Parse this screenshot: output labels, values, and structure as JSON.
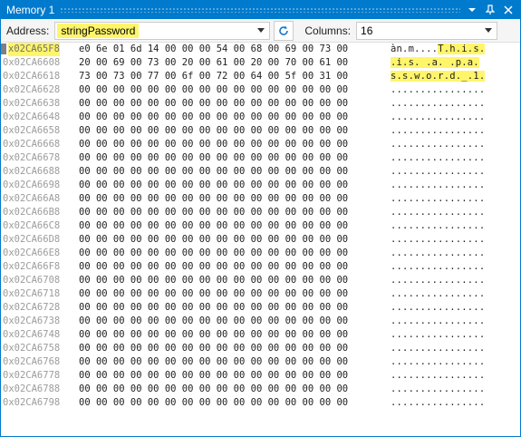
{
  "window": {
    "title": "Memory 1",
    "title_icons": [
      "dropdown-icon",
      "pin-icon",
      "close-icon"
    ],
    "accent": "#007acc"
  },
  "toolbar": {
    "address_label": "Address:",
    "address_value": "stringPassword",
    "columns_label": "Columns:",
    "columns_value": "16",
    "highlight_color": "#fff56b"
  },
  "rows": [
    {
      "addr": "x02CA65F8",
      "hex": "e0 6e 01 6d 14 00 00 00 54 00 68 00 69 00 73 00",
      "ascii_pre": "àn.m....",
      "ascii_hl": "T.h.i.s."
    },
    {
      "addr": "0x02CA6608",
      "hex": "20 00 69 00 73 00 20 00 61 00 20 00 70 00 61 00",
      "ascii_pre": "",
      "ascii_hl": ".i.s. .a. .p.a."
    },
    {
      "addr": "0x02CA6618",
      "hex": "73 00 73 00 77 00 6f 00 72 00 64 00 5f 00 31 00",
      "ascii_pre": "",
      "ascii_hl": "s.s.w.o.r.d._.1."
    },
    {
      "addr": "0x02CA6628",
      "hex": "00 00 00 00 00 00 00 00 00 00 00 00 00 00 00 00",
      "ascii_pre": "................",
      "ascii_hl": ""
    },
    {
      "addr": "0x02CA6638",
      "hex": "00 00 00 00 00 00 00 00 00 00 00 00 00 00 00 00",
      "ascii_pre": "................",
      "ascii_hl": ""
    },
    {
      "addr": "0x02CA6648",
      "hex": "00 00 00 00 00 00 00 00 00 00 00 00 00 00 00 00",
      "ascii_pre": "................",
      "ascii_hl": ""
    },
    {
      "addr": "0x02CA6658",
      "hex": "00 00 00 00 00 00 00 00 00 00 00 00 00 00 00 00",
      "ascii_pre": "................",
      "ascii_hl": ""
    },
    {
      "addr": "0x02CA6668",
      "hex": "00 00 00 00 00 00 00 00 00 00 00 00 00 00 00 00",
      "ascii_pre": "................",
      "ascii_hl": ""
    },
    {
      "addr": "0x02CA6678",
      "hex": "00 00 00 00 00 00 00 00 00 00 00 00 00 00 00 00",
      "ascii_pre": "................",
      "ascii_hl": ""
    },
    {
      "addr": "0x02CA6688",
      "hex": "00 00 00 00 00 00 00 00 00 00 00 00 00 00 00 00",
      "ascii_pre": "................",
      "ascii_hl": ""
    },
    {
      "addr": "0x02CA6698",
      "hex": "00 00 00 00 00 00 00 00 00 00 00 00 00 00 00 00",
      "ascii_pre": "................",
      "ascii_hl": ""
    },
    {
      "addr": "0x02CA66A8",
      "hex": "00 00 00 00 00 00 00 00 00 00 00 00 00 00 00 00",
      "ascii_pre": "................",
      "ascii_hl": ""
    },
    {
      "addr": "0x02CA66B8",
      "hex": "00 00 00 00 00 00 00 00 00 00 00 00 00 00 00 00",
      "ascii_pre": "................",
      "ascii_hl": ""
    },
    {
      "addr": "0x02CA66C8",
      "hex": "00 00 00 00 00 00 00 00 00 00 00 00 00 00 00 00",
      "ascii_pre": "................",
      "ascii_hl": ""
    },
    {
      "addr": "0x02CA66D8",
      "hex": "00 00 00 00 00 00 00 00 00 00 00 00 00 00 00 00",
      "ascii_pre": "................",
      "ascii_hl": ""
    },
    {
      "addr": "0x02CA66E8",
      "hex": "00 00 00 00 00 00 00 00 00 00 00 00 00 00 00 00",
      "ascii_pre": "................",
      "ascii_hl": ""
    },
    {
      "addr": "0x02CA66F8",
      "hex": "00 00 00 00 00 00 00 00 00 00 00 00 00 00 00 00",
      "ascii_pre": "................",
      "ascii_hl": ""
    },
    {
      "addr": "0x02CA6708",
      "hex": "00 00 00 00 00 00 00 00 00 00 00 00 00 00 00 00",
      "ascii_pre": "................",
      "ascii_hl": ""
    },
    {
      "addr": "0x02CA6718",
      "hex": "00 00 00 00 00 00 00 00 00 00 00 00 00 00 00 00",
      "ascii_pre": "................",
      "ascii_hl": ""
    },
    {
      "addr": "0x02CA6728",
      "hex": "00 00 00 00 00 00 00 00 00 00 00 00 00 00 00 00",
      "ascii_pre": "................",
      "ascii_hl": ""
    },
    {
      "addr": "0x02CA6738",
      "hex": "00 00 00 00 00 00 00 00 00 00 00 00 00 00 00 00",
      "ascii_pre": "................",
      "ascii_hl": ""
    },
    {
      "addr": "0x02CA6748",
      "hex": "00 00 00 00 00 00 00 00 00 00 00 00 00 00 00 00",
      "ascii_pre": "................",
      "ascii_hl": ""
    },
    {
      "addr": "0x02CA6758",
      "hex": "00 00 00 00 00 00 00 00 00 00 00 00 00 00 00 00",
      "ascii_pre": "................",
      "ascii_hl": ""
    },
    {
      "addr": "0x02CA6768",
      "hex": "00 00 00 00 00 00 00 00 00 00 00 00 00 00 00 00",
      "ascii_pre": "................",
      "ascii_hl": ""
    },
    {
      "addr": "0x02CA6778",
      "hex": "00 00 00 00 00 00 00 00 00 00 00 00 00 00 00 00",
      "ascii_pre": "................",
      "ascii_hl": ""
    },
    {
      "addr": "0x02CA6788",
      "hex": "00 00 00 00 00 00 00 00 00 00 00 00 00 00 00 00",
      "ascii_pre": "................",
      "ascii_hl": ""
    },
    {
      "addr": "0x02CA6798",
      "hex": "00 00 00 00 00 00 00 00 00 00 00 00 00 00 00 00",
      "ascii_pre": "................",
      "ascii_hl": ""
    }
  ]
}
